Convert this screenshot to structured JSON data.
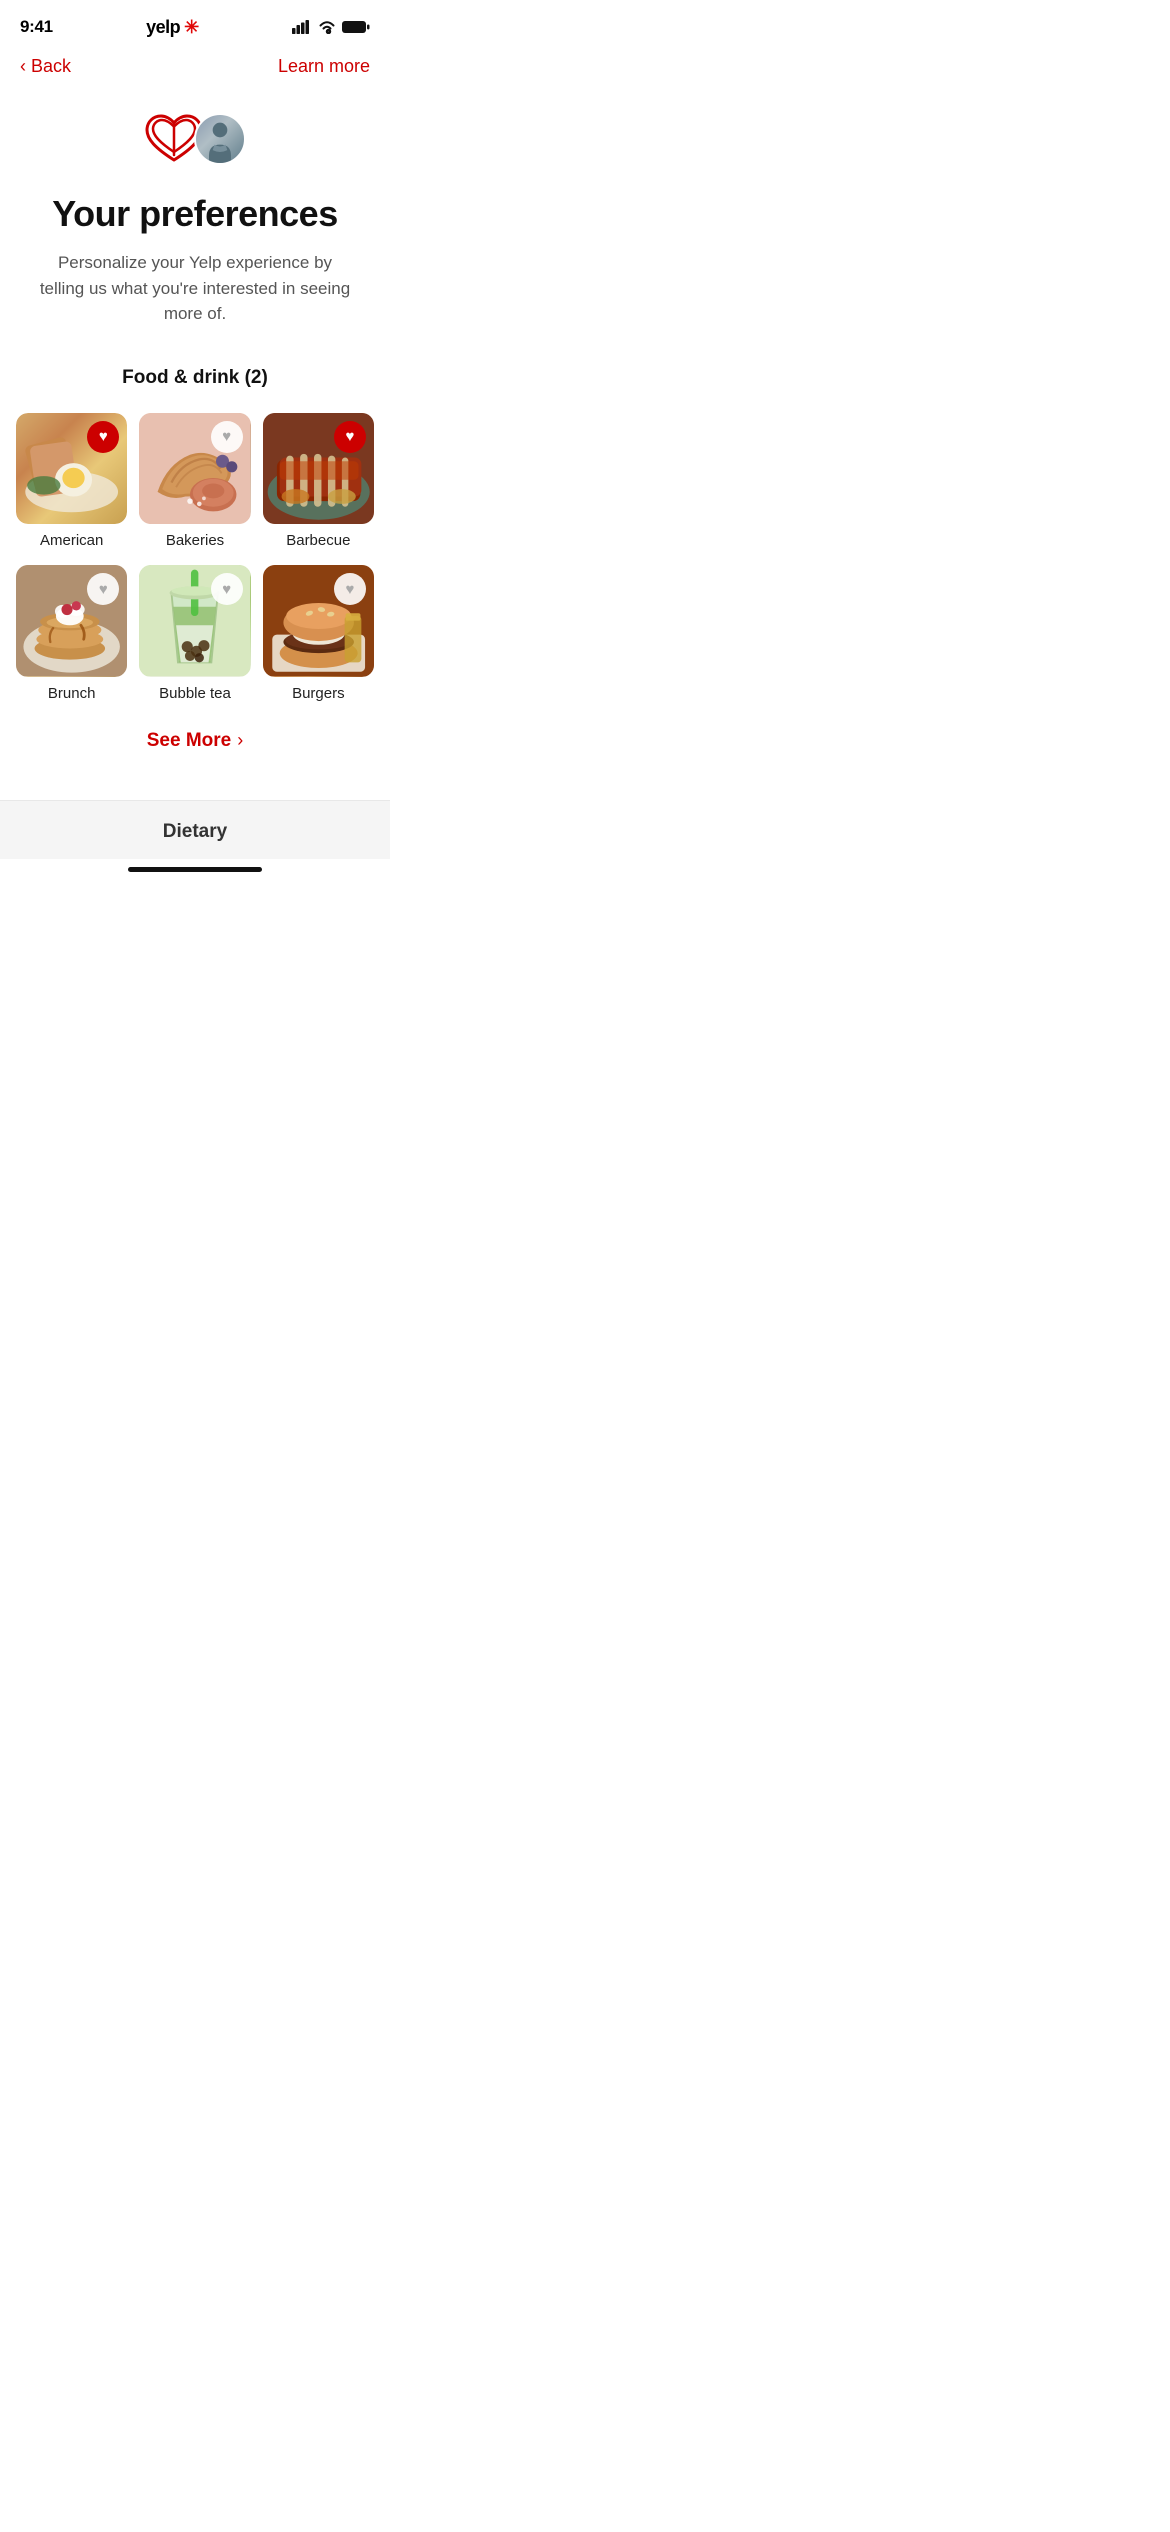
{
  "status_bar": {
    "time": "9:41",
    "app_name": "yelp",
    "star_symbol": "✳"
  },
  "nav": {
    "back_label": "Back",
    "learn_more_label": "Learn more"
  },
  "header": {
    "title": "Your preferences",
    "subtitle": "Personalize your Yelp experience by telling us what you're interested in seeing more of."
  },
  "food_section": {
    "title": "Food & drink (2)"
  },
  "categories": [
    {
      "label": "American",
      "filled": true
    },
    {
      "label": "Bakeries",
      "filled": false
    },
    {
      "label": "Barbecue",
      "filled": true
    },
    {
      "label": "Brunch",
      "filled": false
    },
    {
      "label": "Bubble tea",
      "filled": false
    },
    {
      "label": "Burgers",
      "filled": false
    }
  ],
  "see_more": {
    "label": "See More"
  },
  "dietary_section": {
    "label": "Dietary"
  }
}
